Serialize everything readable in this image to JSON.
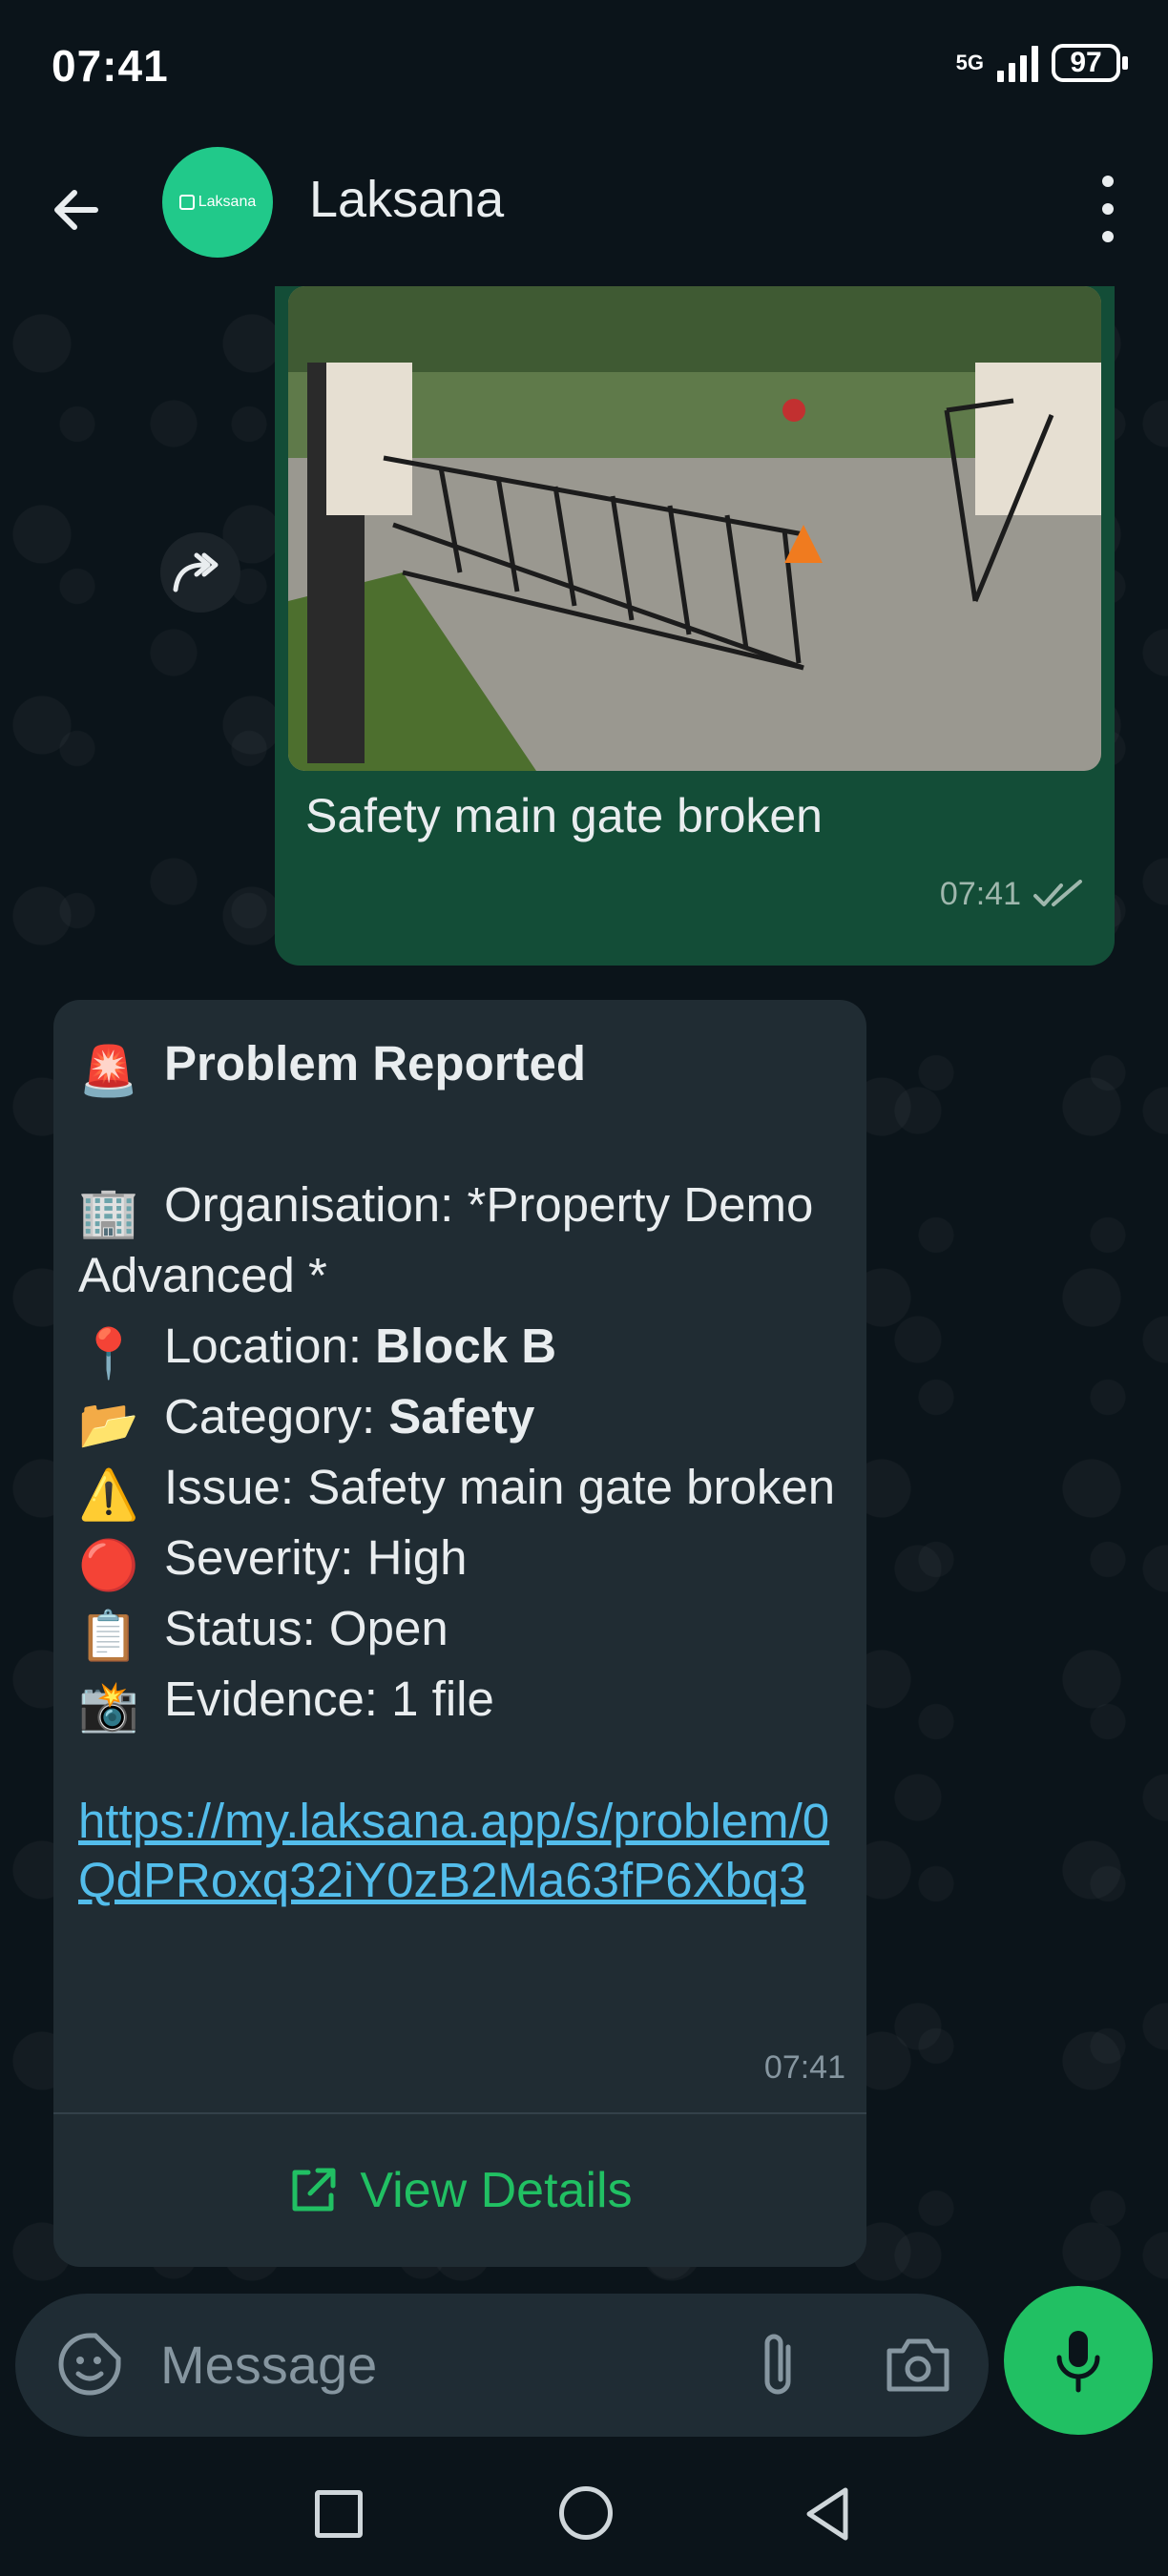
{
  "status_bar": {
    "time": "07:41",
    "network": "5G",
    "battery": "97"
  },
  "header": {
    "avatar_text": "Laksana",
    "contact_name": "Laksana",
    "icons": {
      "back": "arrow-left-icon",
      "menu": "more-vert-icon"
    }
  },
  "messages": {
    "outgoing": {
      "image_description_icon": "photo",
      "caption": "Safety main gate broken",
      "time": "07:41",
      "status_icon": "double-check-icon"
    },
    "incoming": {
      "title_emoji": "🚨",
      "title": "Problem Reported",
      "organisation_emoji": "🏢",
      "organisation": "Organisation: *Property Demo Advanced *",
      "location_emoji": "📍",
      "location_label": "Location: ",
      "location_value": "Block B",
      "category_emoji": "📂",
      "category_label": "Category: ",
      "category_value": "Safety",
      "issue_emoji": "⚠️",
      "issue": "Issue: Safety main gate broken",
      "severity_emoji": "🔴",
      "severity": "Severity: High",
      "status_emoji": "📋",
      "status": "Status: Open",
      "evidence_emoji": "📸",
      "evidence": "Evidence: 1 file",
      "link": "https://my.laksana.app/s/problem/0QdPRoxq32iY0zB2Ma63fP6Xbq3",
      "time": "07:41",
      "action_label": "View Details",
      "action_icon": "external-link-icon"
    }
  },
  "input_bar": {
    "placeholder": "Message",
    "icons": [
      "sticker-icon",
      "attach-icon",
      "camera-icon",
      "mic-icon"
    ]
  },
  "colors": {
    "background": "#0b141a",
    "outgoing_bubble": "#134d37",
    "incoming_bubble": "#202c33",
    "accent_green": "#21c063",
    "link": "#53bdeb"
  }
}
